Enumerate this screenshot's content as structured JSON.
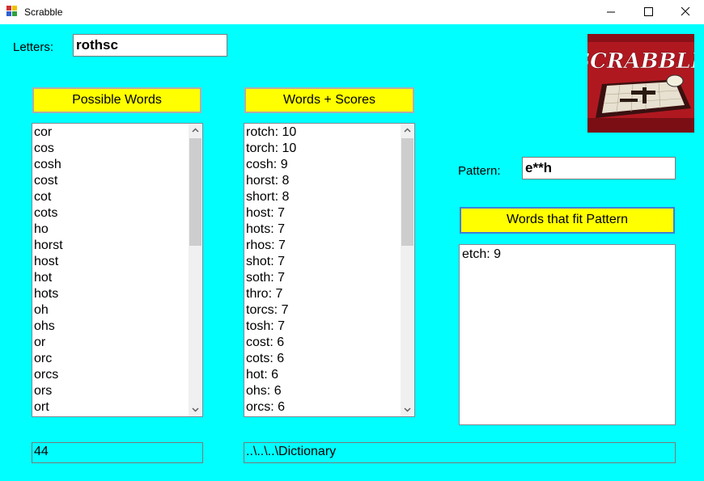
{
  "window": {
    "title": "Scrabble"
  },
  "letters": {
    "label": "Letters:",
    "value": "rothsc"
  },
  "possible": {
    "button_label": "Possible Words",
    "items": [
      "cor",
      "cos",
      "cosh",
      "cost",
      "cot",
      "cots",
      "ho",
      "horst",
      "host",
      "hot",
      "hots",
      "oh",
      "ohs",
      "or",
      "orc",
      "orcs",
      "ors",
      "ort"
    ],
    "scroll_fraction": 0.0
  },
  "scores": {
    "button_label": "Words + Scores",
    "items": [
      "rotch: 10",
      "torch: 10",
      "cosh: 9",
      "horst: 8",
      "short: 8",
      "host: 7",
      "hots: 7",
      "rhos: 7",
      "shot: 7",
      "soth: 7",
      "thro: 7",
      "torcs: 7",
      "tosh: 7",
      "cost: 6",
      "cots: 6",
      "hot: 6",
      "ohs: 6",
      "orcs: 6"
    ],
    "scroll_fraction": 0.0
  },
  "pattern": {
    "label": "Pattern:",
    "value": "e**h",
    "button_label": "Words that fit Pattern",
    "items": [
      "etch: 9"
    ]
  },
  "status": {
    "count": "44",
    "path": "..\\..\\..\\Dictionary"
  },
  "logo": {
    "text": "SCRABBLE",
    "colors": {
      "box": "#b01820",
      "board": "#e8e0d0",
      "frame": "#3a1010"
    }
  }
}
